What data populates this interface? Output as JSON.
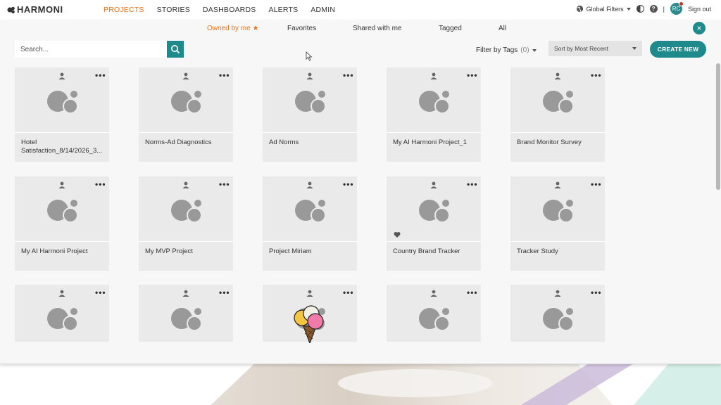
{
  "app": {
    "logo_text": "HARMONI"
  },
  "nav": {
    "items": [
      {
        "label": "PROJECTS",
        "active": true
      },
      {
        "label": "STORIES",
        "active": false
      },
      {
        "label": "DASHBOARDS",
        "active": false
      },
      {
        "label": "ALERTS",
        "active": false
      },
      {
        "label": "ADMIN",
        "active": false
      }
    ],
    "global_filters": "Global Filters",
    "help": "?",
    "sep": "|",
    "avatar_initials": "RC",
    "sign_out": "Sign out"
  },
  "tabs": {
    "items": [
      {
        "label": "Owned by me",
        "active": true,
        "star": "★"
      },
      {
        "label": "Favorites",
        "active": false
      },
      {
        "label": "Shared with me",
        "active": false
      },
      {
        "label": "Tagged",
        "active": false
      },
      {
        "label": "All",
        "active": false
      }
    ],
    "close": "×"
  },
  "toolbar": {
    "search_placeholder": "Search...",
    "filter_label": "Filter by Tags",
    "filter_count": "(0)",
    "sort_label": "Sort by Most Recent",
    "create_label": "CREATE NEW",
    "more_label": "•••"
  },
  "projects": [
    {
      "name": "Hotel Satisfaction_8/14/2026_3...",
      "favorite": false
    },
    {
      "name": "Norms-Ad Diagnostics",
      "favorite": false
    },
    {
      "name": "Ad Norms",
      "favorite": false
    },
    {
      "name": "My AI Harmoni Project_1",
      "favorite": false
    },
    {
      "name": "Brand Monitor Survey",
      "favorite": false
    },
    {
      "name": "My AI Harmoni Project",
      "favorite": false
    },
    {
      "name": "My MVP Project",
      "favorite": false
    },
    {
      "name": "Project Miriam",
      "favorite": false
    },
    {
      "name": "Country Brand Tracker",
      "favorite": true
    },
    {
      "name": "Tracker Study",
      "favorite": false
    },
    {
      "name": "",
      "favorite": false
    },
    {
      "name": "",
      "favorite": false
    },
    {
      "name": "",
      "favorite": false
    },
    {
      "name": "",
      "favorite": false
    },
    {
      "name": "",
      "favorite": false
    }
  ],
  "colors": {
    "accent": "#1e8a8c",
    "active_nav": "#e8731a",
    "card_bg": "#eaeaea",
    "bubble": "#999999"
  }
}
